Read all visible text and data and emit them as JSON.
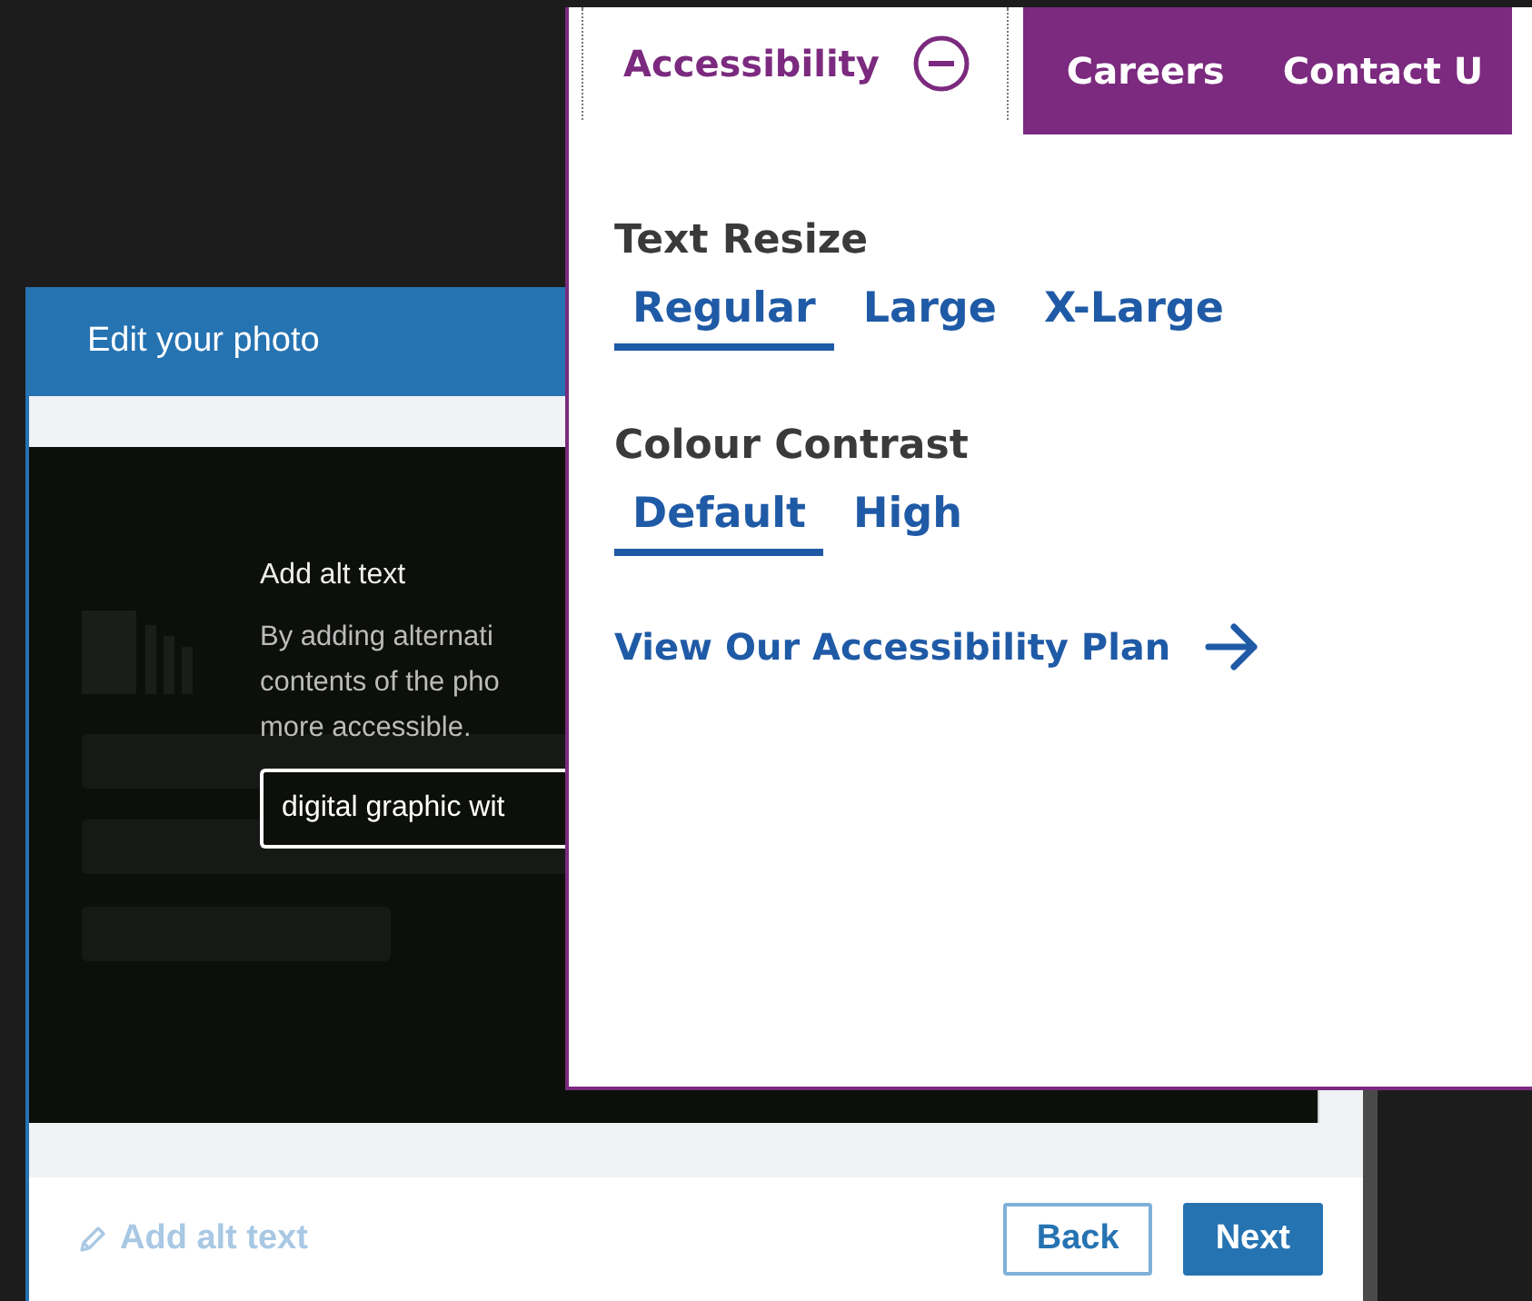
{
  "dialog": {
    "title": "Edit your photo",
    "alt_text": {
      "label": "Add alt text",
      "description_lines": [
        "By adding alternati",
        "contents of the pho",
        "more accessible."
      ],
      "value": "digital graphic wit"
    },
    "footer_link": {
      "label": "Add alt text",
      "disabled": true
    },
    "buttons": [
      {
        "label": "Back",
        "kind": "secondary"
      },
      {
        "label": "Next",
        "kind": "primary"
      }
    ]
  },
  "accessibility_panel": {
    "tabs": [
      {
        "label": "Accessibility",
        "selected": true,
        "expanded": true
      },
      {
        "label": "Careers",
        "selected": false,
        "expanded": false
      },
      {
        "label": "Contact U",
        "selected": false,
        "expanded": false
      }
    ],
    "sections": [
      {
        "heading": "Text Resize",
        "options": [
          {
            "label": "Regular",
            "selected": true
          },
          {
            "label": "Large",
            "selected": false
          },
          {
            "label": "X-Large",
            "selected": false
          }
        ]
      },
      {
        "heading": "Colour Contrast",
        "options": [
          {
            "label": "Default",
            "selected": true
          },
          {
            "label": "High",
            "selected": false
          }
        ]
      }
    ],
    "link": "View Our Accessibility Plan"
  }
}
